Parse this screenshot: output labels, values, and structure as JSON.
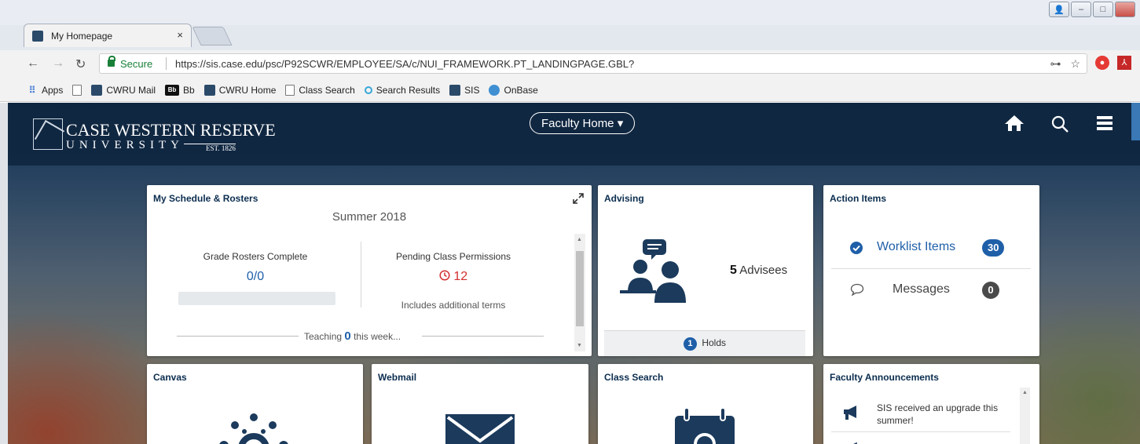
{
  "browser": {
    "tab_title": "My Homepage",
    "tab_close": "×",
    "secure_label": "Secure",
    "url": "https://sis.case.edu/psc/P92SCWR/EMPLOYEE/SA/c/NUI_FRAMEWORK.PT_LANDINGPAGE.GBL?",
    "bookmarks": [
      {
        "label": "Apps",
        "icon": "apps-grid-icon"
      },
      {
        "label": "",
        "icon": "page-icon"
      },
      {
        "label": "CWRU Mail",
        "icon": "cwru-icon"
      },
      {
        "label": "Bb",
        "icon": "blackboard-icon"
      },
      {
        "label": "CWRU Home",
        "icon": "cwru-icon"
      },
      {
        "label": "Class Search",
        "icon": "page-icon"
      },
      {
        "label": "Search Results",
        "icon": "search-results-icon"
      },
      {
        "label": "SIS",
        "icon": "cwru-icon"
      },
      {
        "label": "OnBase",
        "icon": "onbase-icon"
      }
    ]
  },
  "header": {
    "logo_name": "CASE WESTERN RESERVE",
    "logo_university": "UNIVERSITY",
    "logo_est": "EST. 1826",
    "nav_title": "Faculty Home ▾"
  },
  "tiles": {
    "schedule": {
      "title": "My Schedule & Rosters",
      "term": "Summer 2018",
      "grade_label": "Grade Rosters Complete",
      "grade_value": "0/0",
      "pending_label": "Pending Class Permissions",
      "pending_value": "12",
      "pending_note": "Includes additional terms",
      "teaching_prefix": "Teaching",
      "teaching_count": "0",
      "teaching_suffix": "this week..."
    },
    "advising": {
      "title": "Advising",
      "advisee_count": "5",
      "advisee_label": "Advisees",
      "holds_count": "1",
      "holds_label": "Holds"
    },
    "action_items": {
      "title": "Action Items",
      "worklist_label": "Worklist Items",
      "worklist_count": "30",
      "messages_label": "Messages",
      "messages_count": "0"
    },
    "canvas": {
      "title": "Canvas"
    },
    "webmail": {
      "title": "Webmail"
    },
    "class_search": {
      "title": "Class Search"
    },
    "announcements": {
      "title": "Faculty Announcements",
      "item1": "SIS received an upgrade this summer!"
    }
  },
  "colors": {
    "header_navy": "#0f2640",
    "accent_blue": "#1f5fa8",
    "title_navy": "#0b2d4f",
    "pending_red": "#d32f2f"
  }
}
